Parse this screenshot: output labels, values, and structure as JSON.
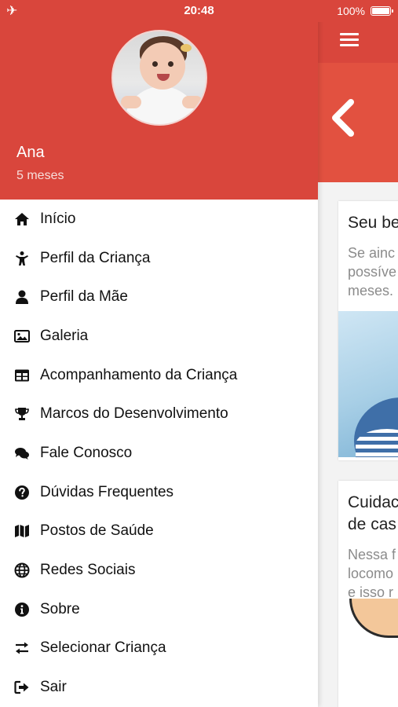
{
  "status_bar": {
    "airplane_icon": "airplane-icon",
    "time": "20:48",
    "battery_percent": "100%"
  },
  "drawer": {
    "profile": {
      "name": "Ana",
      "age": "5 meses"
    },
    "menu": [
      {
        "label": "Início",
        "icon": "home-icon"
      },
      {
        "label": "Perfil da Criança",
        "icon": "child-icon"
      },
      {
        "label": "Perfil da Mãe",
        "icon": "user-icon"
      },
      {
        "label": "Galeria",
        "icon": "image-icon"
      },
      {
        "label": "Acompanhamento da Criança",
        "icon": "table-icon"
      },
      {
        "label": "Marcos do Desenvolvimento",
        "icon": "trophy-icon"
      },
      {
        "label": "Fale Conosco",
        "icon": "comments-icon"
      },
      {
        "label": "Dúvidas Frequentes",
        "icon": "question-circle-icon"
      },
      {
        "label": "Postos de Saúde",
        "icon": "map-icon"
      },
      {
        "label": "Redes Sociais",
        "icon": "globe-icon"
      },
      {
        "label": "Sobre",
        "icon": "info-circle-icon"
      },
      {
        "label": "Selecionar Criança",
        "icon": "exchange-icon"
      },
      {
        "label": "Sair",
        "icon": "sign-out-icon"
      }
    ]
  },
  "background_page": {
    "card1": {
      "title": "Seu be",
      "text_lines": [
        "Se ainc",
        "possíve",
        "meses."
      ]
    },
    "card2": {
      "title_lines": [
        "Cuidac",
        "de cas"
      ],
      "text_lines": [
        "Nessa f",
        "locomo",
        "e isso r"
      ]
    }
  },
  "colors": {
    "primary": "#d9463c",
    "banner": "#e25140",
    "text": "#111111",
    "muted": "#8b8b8b"
  }
}
